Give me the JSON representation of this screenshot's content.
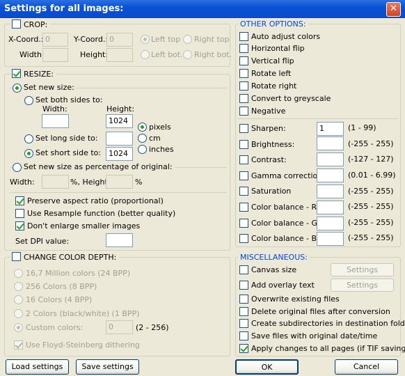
{
  "window": {
    "title": "Settings for all images:",
    "close": "✕"
  },
  "crop": {
    "title": "CROP:",
    "checked": false,
    "xcoord_label": "X-Coord.:",
    "xcoord": "0",
    "ycoord_label": "Y-Coord.:",
    "ycoord": "0",
    "width_label": "Width:",
    "height_label": "Height:",
    "left_top": "Left top",
    "right_top": "Right top",
    "left_bot": "Left bot.",
    "right_bot": "Right bot."
  },
  "resize": {
    "title": "RESIZE:",
    "checked": true,
    "set_new_size": "Set new size:",
    "both_sides": "Set both sides to:",
    "width_label": "Width:",
    "height_label": "Height:",
    "height_value": "1024",
    "pixels": "pixels",
    "cm": "cm",
    "inches": "inches",
    "long_side": "Set long side to:",
    "short_side": "Set short side to:",
    "short_value": "1024",
    "percentage": "Set new size as percentage of original:",
    "pct_width_label": "Width:",
    "pct_height_label": "%, Height:",
    "pct_unit": "%",
    "preserve_aspect": "Preserve aspect ratio (proportional)",
    "resample": "Use Resample function (better quality)",
    "dont_enlarge": "Don't enlarge smaller images",
    "dpi_label": "Set DPI value:"
  },
  "color_depth": {
    "title": "CHANGE COLOR DEPTH:",
    "opt24": "16,7 Million colors (24 BPP)",
    "opt8": "256 Colors (8 BPP)",
    "opt4": "16 Colors (4 BPP)",
    "opt1": "2 Colors (black/white) (1 BPP)",
    "custom": "Custom colors:",
    "custom_value": "0",
    "custom_range": "(2 - 256)",
    "dithering": "Use Floyd-Steinberg dithering"
  },
  "other": {
    "title": "OTHER OPTIONS:",
    "auto_adjust": "Auto adjust colors",
    "hflip": "Horizontal flip",
    "vflip": "Vertical flip",
    "rotate_left": "Rotate left",
    "rotate_right": "Rotate right",
    "greyscale": "Convert to greyscale",
    "negative": "Negative",
    "adjust": [
      {
        "label": "Sharpen:",
        "value": "1",
        "range": "(1  -  99)"
      },
      {
        "label": "Brightness:",
        "value": "",
        "range": "(-255  -  255)"
      },
      {
        "label": "Contrast:",
        "value": "",
        "range": "(-127  -  127)"
      },
      {
        "label": "Gamma correction:",
        "value": "",
        "range": "(0.01  -  6.99)"
      },
      {
        "label": "Saturation",
        "value": "",
        "range": "(-255  -  255)"
      },
      {
        "label": "Color balance - R:",
        "value": "",
        "range": "(-255  -  255)"
      },
      {
        "label": "Color balance - G:",
        "value": "",
        "range": "(-255  -  255)"
      },
      {
        "label": "Color balance - B:",
        "value": "",
        "range": "(-255  -  255)"
      }
    ]
  },
  "misc": {
    "title": "MISCELLANEOUS:",
    "canvas_size": "Canvas size",
    "overlay_text": "Add overlay text",
    "settings": "Settings",
    "overwrite": "Overwrite existing files",
    "delete_orig": "Delete original files after conversion",
    "create_subdirs": "Create subdirectories in destination folder",
    "save_date": "Save files with original date/time",
    "apply_all": "Apply changes to all pages (if TIF saving)"
  },
  "buttons": {
    "load": "Load settings",
    "save": "Save settings",
    "ok": "OK",
    "cancel": "Cancel"
  }
}
